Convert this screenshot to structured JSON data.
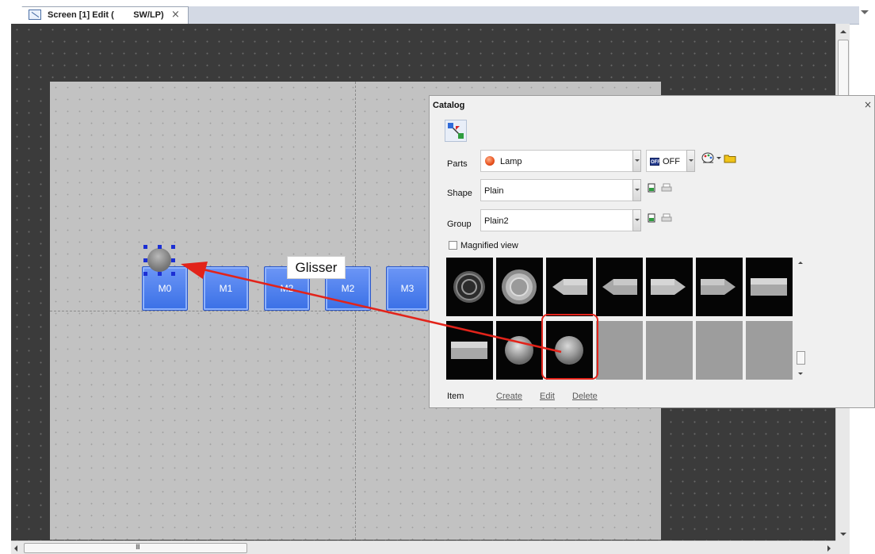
{
  "tab": {
    "title": "Screen [1] Edit (        SW/LP)",
    "close": "×"
  },
  "screen": {
    "buttons": [
      "M0",
      "M1",
      "M2",
      "M2",
      "M3"
    ],
    "drag_label": "Glisser"
  },
  "catalog": {
    "title": "Catalog",
    "close": "×",
    "parts": {
      "label": "Parts",
      "value": "Lamp"
    },
    "state": {
      "badge": "OFF",
      "value": "OFF"
    },
    "shape": {
      "label": "Shape",
      "value": "Plain"
    },
    "group": {
      "label": "Group",
      "value": "Plain2"
    },
    "magnified": {
      "label": "Magnified view",
      "checked": false
    },
    "footer": {
      "item_label": "Item",
      "create": "Create",
      "edit": "Edit",
      "delete": "Delete"
    },
    "tiles": [
      {
        "kind": "ring-dark"
      },
      {
        "kind": "ring-light"
      },
      {
        "kind": "arrow-left"
      },
      {
        "kind": "arrow-left-2"
      },
      {
        "kind": "arrow-right"
      },
      {
        "kind": "arrow-right-2"
      },
      {
        "kind": "bar"
      },
      {
        "kind": "bar"
      },
      {
        "kind": "sphere"
      },
      {
        "kind": "sphere-selected"
      },
      {
        "kind": "empty"
      },
      {
        "kind": "empty"
      },
      {
        "kind": "empty"
      },
      {
        "kind": "empty"
      }
    ],
    "selected_tile_index": 9
  },
  "colors": {
    "accent": "#e2231a",
    "button": "#4a7ef0",
    "handle": "#1c2fd4",
    "workspace": "#3b3b3b",
    "screen": "#c2c2c2"
  },
  "hscroll_grip": "III"
}
